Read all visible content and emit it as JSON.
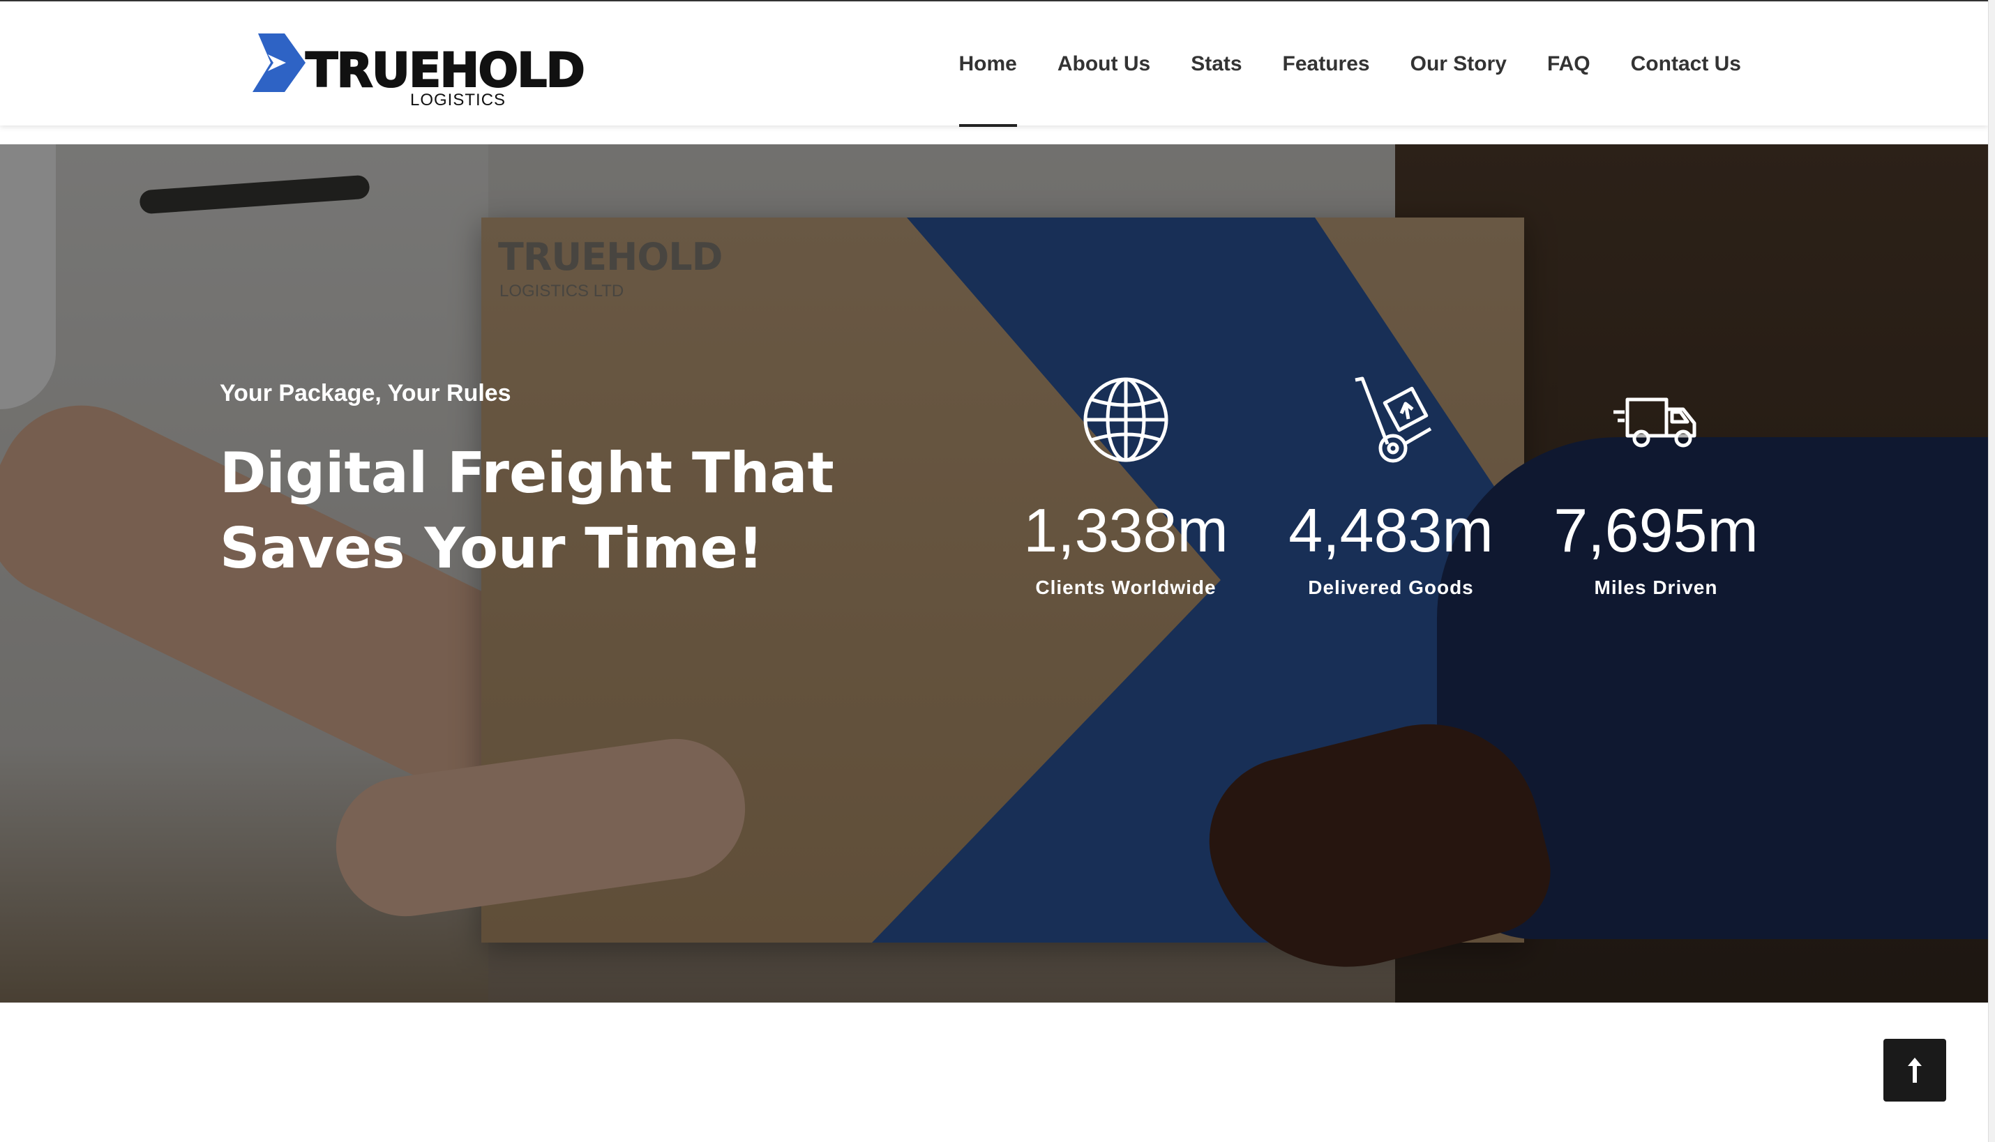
{
  "header": {
    "logo": {
      "word": "TRUEHOLD",
      "sub": "LOGISTICS",
      "icon": "arrow-logo-icon",
      "brand_color": "#2e63c5"
    },
    "nav": [
      {
        "label": "Home",
        "active": true
      },
      {
        "label": "About Us",
        "active": false
      },
      {
        "label": "Stats",
        "active": false
      },
      {
        "label": "Features",
        "active": false
      },
      {
        "label": "Our Story",
        "active": false
      },
      {
        "label": "FAQ",
        "active": false
      },
      {
        "label": "Contact Us",
        "active": false
      }
    ]
  },
  "hero": {
    "kicker": "Your Package, Your Rules",
    "title_line1": "Digital Freight That",
    "title_line2": "Saves Your Time!",
    "box_brand": "TRUEHOLD",
    "box_brand_sub": "LOGISTICS LTD",
    "stats": [
      {
        "icon": "globe-icon",
        "value": "1,338m",
        "label": "Clients Worldwide"
      },
      {
        "icon": "hand-truck-icon",
        "value": "4,483m",
        "label": "Delivered Goods"
      },
      {
        "icon": "delivery-truck-icon",
        "value": "7,695m",
        "label": "Miles Driven"
      }
    ]
  },
  "scroll_to_top": {
    "icon": "arrow-up-icon"
  },
  "colors": {
    "accent_blue": "#2e5aa6",
    "text_dark": "#333333",
    "button_dark": "#1a1a1a"
  }
}
